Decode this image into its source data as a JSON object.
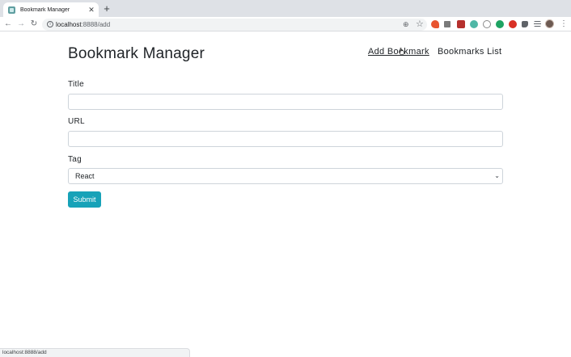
{
  "browser": {
    "tab": {
      "title": "Bookmark Manager",
      "close_glyph": "✕"
    },
    "new_tab_glyph": "+",
    "nav": {
      "back": "←",
      "forward": "→",
      "reload": "↻"
    },
    "omnibox": {
      "host": "localhost",
      "rest": ":8888/add"
    },
    "extensions": [
      {
        "icon": "extension-red-icon",
        "color": "#e8542f"
      },
      {
        "icon": "extension-gray-icon",
        "color": "#7a7a7a"
      },
      {
        "icon": "extension-maroon-icon",
        "color": "#b5302d"
      },
      {
        "icon": "extension-teal-icon",
        "color": "#4fb7a6"
      },
      {
        "icon": "extension-smile-icon",
        "color": "#8a8a8a"
      },
      {
        "icon": "extension-green-icon",
        "color": "#1ea362"
      },
      {
        "icon": "extension-redcircle-icon",
        "color": "#d93025"
      },
      {
        "icon": "puzzle-icon",
        "color": "#5f6368"
      },
      {
        "icon": "reading-list-icon",
        "color": "#5f6368"
      }
    ],
    "status_url": "localhost:8888/add"
  },
  "page": {
    "title": "Bookmark Manager",
    "nav": {
      "add": "Add Bookmark",
      "list": "Bookmarks List"
    },
    "form": {
      "title_label": "Title",
      "title_value": "",
      "url_label": "URL",
      "url_value": "",
      "tag_label": "Tag",
      "tag_selected": "React",
      "submit_label": "Submit"
    }
  },
  "colors": {
    "accent": "#17a2b8",
    "text": "#212529",
    "border": "#ced4da"
  }
}
